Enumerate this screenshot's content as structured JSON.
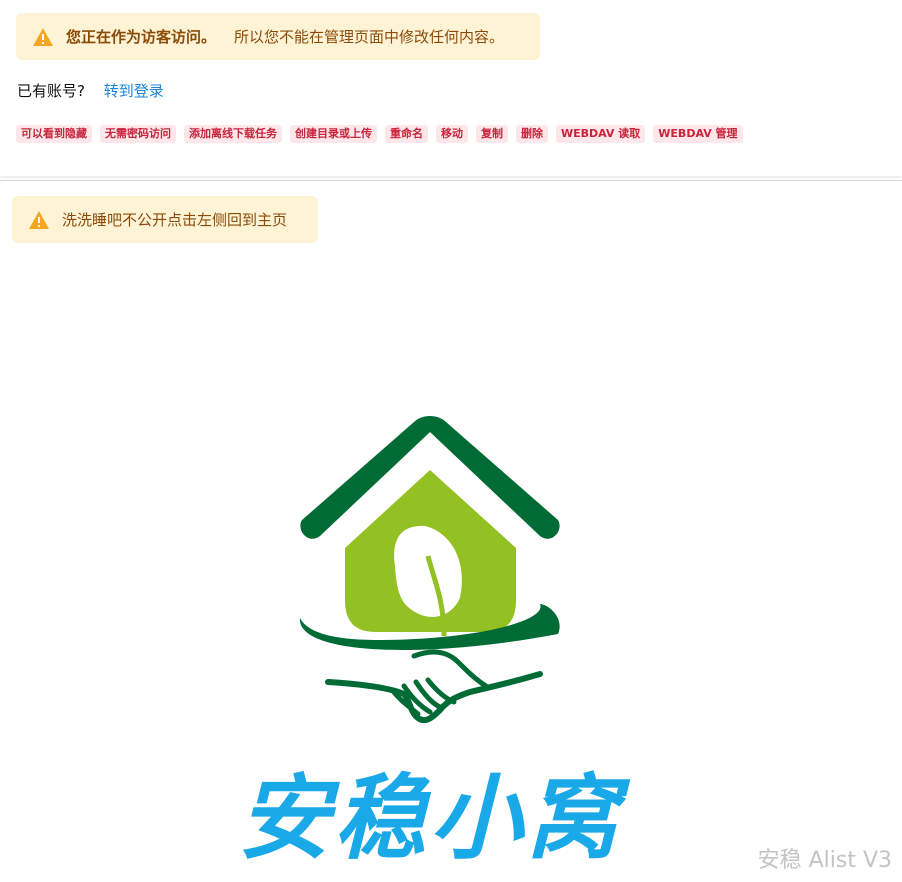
{
  "guest_alert": {
    "title": "您正在作为访客访问。",
    "description": "所以您不能在管理页面中修改任何内容。",
    "icon": "warning-icon"
  },
  "account": {
    "prompt": "已有账号?",
    "login_link": "转到登录"
  },
  "permissions": [
    "可以看到隐藏",
    "无需密码访问",
    "添加离线下载任务",
    "创建目录或上传",
    "重命名",
    "移动",
    "复制",
    "删除",
    "WEBDAV 读取",
    "WEBDAV 管理"
  ],
  "notice_alert": {
    "text": "洗洗睡吧不公开点击左侧回到主页",
    "icon": "warning-icon"
  },
  "logo": {
    "brand_text": "安稳小窝",
    "colors": {
      "roof": "#006b35",
      "house": "#93c123",
      "leaf": "#ffffff",
      "text": "#19a8e8"
    }
  },
  "watermark": "安稳 Alist V3"
}
